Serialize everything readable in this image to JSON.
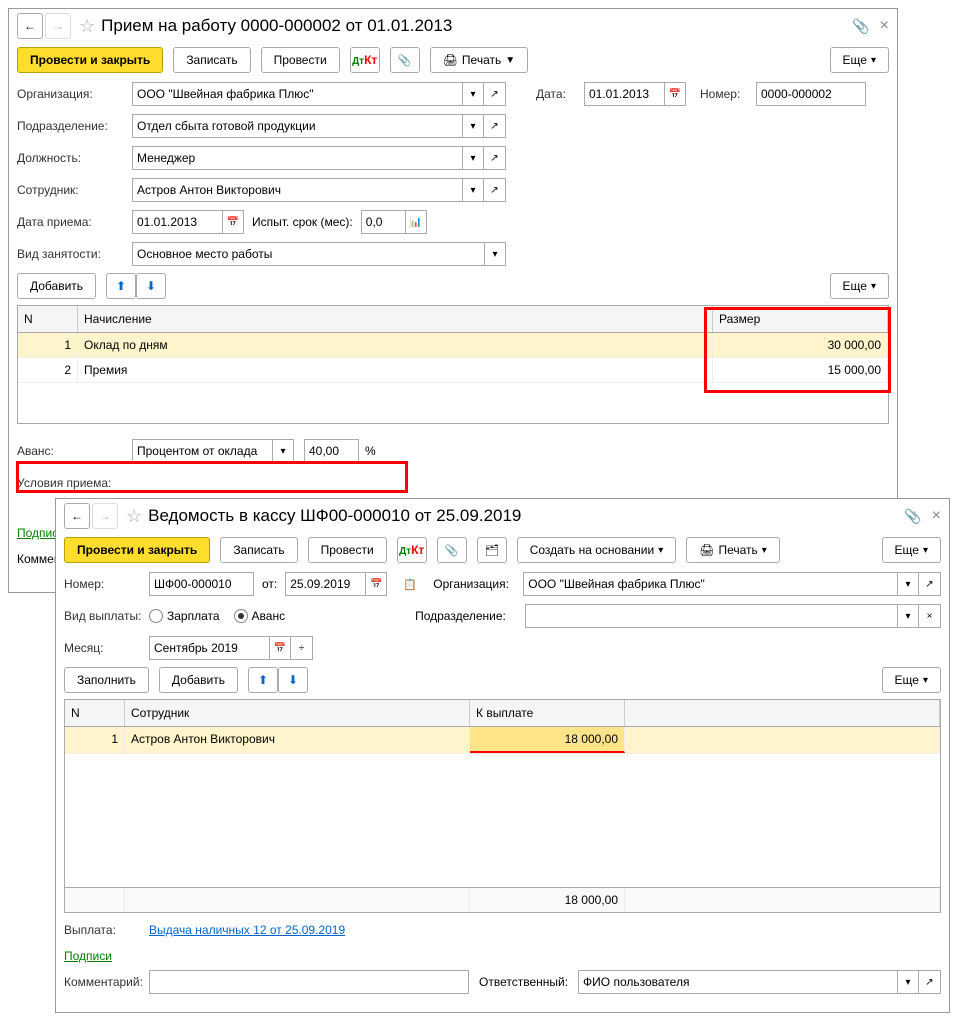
{
  "w1": {
    "title": "Прием на работу 0000-000002 от 01.01.2013",
    "toolbar": {
      "post_close": "Провести и закрыть",
      "save": "Записать",
      "post": "Провести",
      "print": "Печать",
      "more": "Еще"
    },
    "labels": {
      "org": "Организация:",
      "dept": "Подразделение:",
      "pos": "Должность:",
      "emp": "Сотрудник:",
      "hire": "Дата приема:",
      "probation": "Испыт. срок (мес):",
      "type": "Вид занятости:",
      "date": "Дата:",
      "num": "Номер:",
      "advance": "Аванс:",
      "cond": "Условия приема:",
      "sign": "Подписи",
      "comment": "Коммент"
    },
    "values": {
      "org": "ООО \"Швейная фабрика Плюс\"",
      "dept": "Отдел сбыта готовой продукции",
      "pos": "Менеджер",
      "emp": "Астров Антон Викторович",
      "hire": "01.01.2013",
      "probation": "0,0",
      "type": "Основное место работы",
      "date": "01.01.2013",
      "num": "0000-000002",
      "advance_type": "Процентом от оклада",
      "advance_val": "40,00",
      "pct": "%",
      "add": "Добавить"
    },
    "table": {
      "cols": {
        "n": "N",
        "charge": "Начисление",
        "size": "Размер"
      },
      "rows": [
        {
          "n": "1",
          "charge": "Оклад по дням",
          "size": "30 000,00"
        },
        {
          "n": "2",
          "charge": "Премия",
          "size": "15 000,00"
        }
      ]
    }
  },
  "w2": {
    "title": "Ведомость в кассу ШФ00-000010 от 25.09.2019",
    "toolbar": {
      "post_close": "Провести и закрыть",
      "save": "Записать",
      "post": "Провести",
      "create": "Создать на основании",
      "print": "Печать",
      "more": "Еще"
    },
    "labels": {
      "num": "Номер:",
      "from": "от:",
      "org": "Организация:",
      "paytype": "Вид выплаты:",
      "salary": "Зарплата",
      "advance": "Аванс",
      "dept": "Подразделение:",
      "month": "Месяц:",
      "fill": "Заполнить",
      "add": "Добавить",
      "payout": "Выплата:",
      "sign": "Подписи",
      "comment": "Комментарий:",
      "resp": "Ответственный:"
    },
    "values": {
      "num": "ШФ00-000010",
      "from": "25.09.2019",
      "org": "ООО \"Швейная фабрика Плюс\"",
      "month": "Сентябрь 2019",
      "payout_link": "Выдача наличных 12 от 25.09.2019",
      "resp": "ФИО пользователя"
    },
    "table": {
      "cols": {
        "n": "N",
        "emp": "Сотрудник",
        "pay": "К выплате"
      },
      "rows": [
        {
          "n": "1",
          "emp": "Астров Антон Викторович",
          "pay": "18 000,00"
        }
      ],
      "total": "18 000,00"
    }
  }
}
